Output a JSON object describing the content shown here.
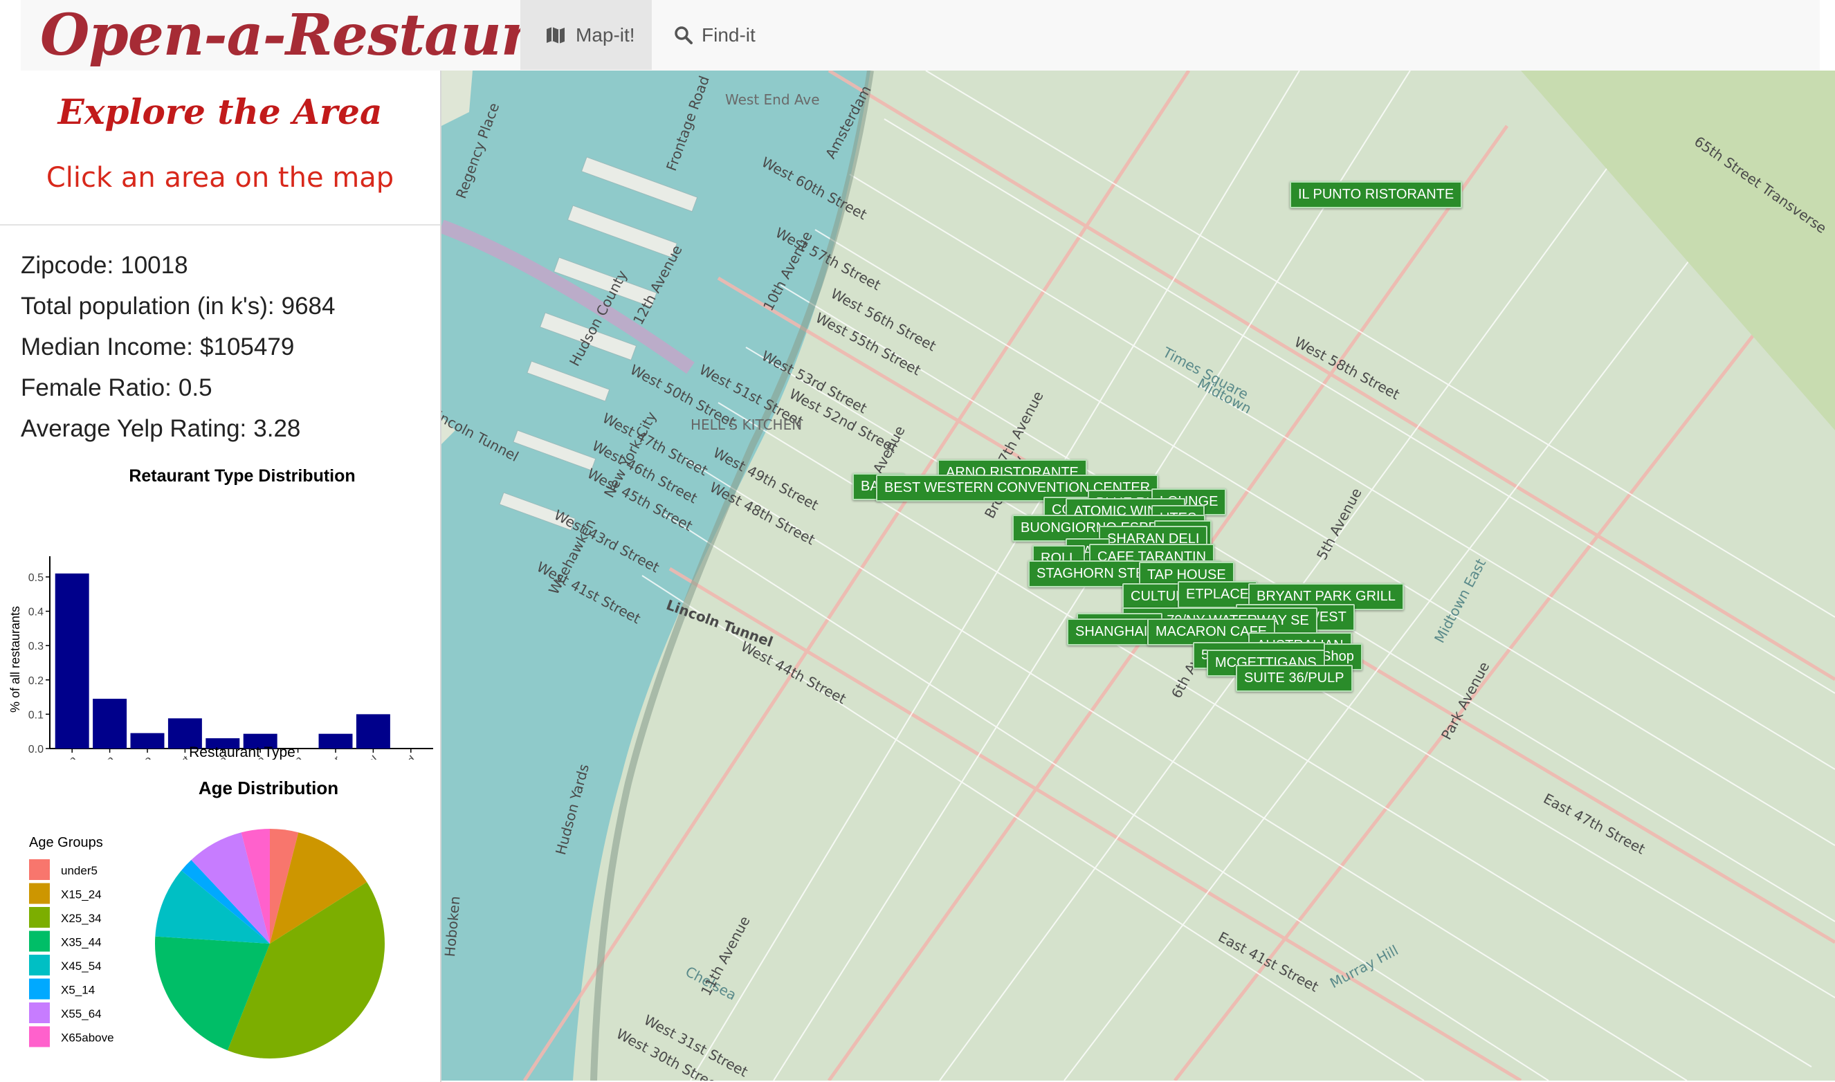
{
  "navbar": {
    "brand": "Open-a-Restaurant",
    "tabs": [
      {
        "label": "Map-it!",
        "icon": "map-icon",
        "active": true
      },
      {
        "label": "Find-it",
        "icon": "search-icon",
        "active": false
      }
    ]
  },
  "sidebar": {
    "title": "Explore the Area",
    "subtitle": "Click an area on the map",
    "stats": {
      "zipcode_label": "Zipcode:",
      "zipcode": "10018",
      "population_label": "Total population (in k's):",
      "population": "9684",
      "income_label": "Median Income:",
      "income": "$105479",
      "female_label": "Female Ratio:",
      "female": "0.5",
      "yelp_label": "Average Yelp Rating:",
      "yelp": "3.28"
    }
  },
  "chart_data": [
    {
      "type": "bar",
      "title": "Retaurant Type Distribution",
      "xlabel": "Restaurant Type",
      "ylabel": "% of all restaurants",
      "categories": [
        "American",
        "Asian",
        "Chinese",
        "Dessert",
        "European",
        "Italian",
        "Mexcian",
        "Other",
        "QuickMeal",
        "Seafood"
      ],
      "values": [
        0.51,
        0.145,
        0.045,
        0.088,
        0.03,
        0.043,
        0,
        0.043,
        0.1,
        0
      ],
      "ylim": [
        0,
        0.52
      ],
      "yticks": [
        "0.0",
        "0.1",
        "0.2",
        "0.3",
        "0.4",
        "0.5"
      ],
      "color": "#00008b"
    },
    {
      "type": "pie",
      "title": "Age Distribution",
      "legend_title": "Age Groups",
      "legend_position": "left",
      "labels": [
        "under5",
        "X15_24",
        "X25_34",
        "X35_44",
        "X45_54",
        "X5_14",
        "X55_64",
        "X65above"
      ],
      "values": [
        4,
        12,
        40,
        20,
        10,
        2,
        8,
        4
      ],
      "colors": [
        "#f8766d",
        "#cd9600",
        "#7cae00",
        "#00be67",
        "#00bfc4",
        "#00a9ff",
        "#c77cff",
        "#ff61cc"
      ]
    }
  ],
  "map": {
    "streets": [
      "West 60th Street",
      "West 57th Street",
      "West 56th Street",
      "West 55th Street",
      "West 53rd Street",
      "West 52nd Street",
      "West 51st Street",
      "West 50th Street",
      "West 49th Street",
      "West 48th Street",
      "West 47th Street",
      "West 46th Street",
      "West 45th Street",
      "West 44th Street",
      "West 43rd Street",
      "West 41st Street",
      "West 58th Street",
      "65th Street Transverse",
      "12th Avenue",
      "10th Avenue",
      "9th Avenue",
      "7th Avenue",
      "Broadway",
      "Lincoln Tunnel",
      "Hudson County",
      "New York City",
      "Weehawken",
      "HELL'S KITCHEN",
      "Times Square",
      "Midtown",
      "Amsterdam",
      "Frontage Road",
      "Hoboken",
      "Chelsea",
      "11th Avenue",
      "West 31st Street",
      "West 30th Street",
      "East 41st Street",
      "Murray Hill",
      "Midtown East",
      "Regency Place",
      "West End Ave",
      "Hudson Yards",
      "5th Avenue",
      "6th Avenue",
      "Park Avenue",
      "East 47th Street"
    ],
    "markers": [
      "IL PUNTO RISTORANTE",
      "ARNO RISTORANTE",
      "BALA",
      "BEST WESTERN CONVENTION CENTER",
      "BLUE RUIN",
      "LOUNGE",
      "COL",
      "ATOMIC WINGS",
      "UTES",
      "BUONGIORNO ESPRESSO",
      "TA CO",
      "SHARAN DELI",
      "KAS",
      "CAFE TARANTIN",
      "ROLL",
      "STAGHORN STEAKHOUSE",
      "TAP HOUSE",
      "CULTURE 36",
      "ETPLACE",
      "BRYANT PARK GRILL",
      "PROPER WEST",
      "PIER 79/NY WATERWAY SE",
      "THE BREA",
      "SHANGHAI BROAD",
      "MACARON CAFE",
      "AUSTRALIAN",
      "Coffee Shop",
      "5 BORO BURGER",
      "MCGETTIGANS",
      "SUITE 36/PULP"
    ]
  }
}
